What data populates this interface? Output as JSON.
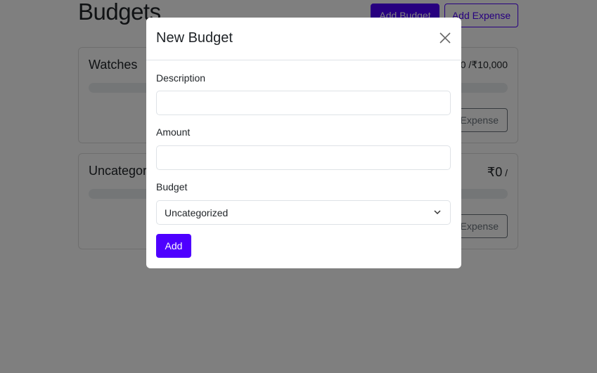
{
  "page": {
    "title": "Budgets",
    "add_budget": "Add Budget",
    "add_expense": "Add Expense"
  },
  "budgets": [
    {
      "name": "Watches",
      "amount": "₹0",
      "max": "/₹10,000",
      "button": "Add Expense",
      "progress": 0
    },
    {
      "name": "Uncategorized",
      "amount": "₹0",
      "max": "/",
      "button": "Add Expense",
      "progress": 0
    }
  ],
  "modal": {
    "title": "New Budget",
    "description_label": "Description",
    "description_value": "",
    "amount_label": "Amount",
    "amount_value": "",
    "budget_label": "Budget",
    "budget_selected": "Uncategorized",
    "submit": "Add"
  },
  "colors": {
    "accent": "#4e00ff",
    "overlay": "rgba(0,0,0,0.5)"
  }
}
